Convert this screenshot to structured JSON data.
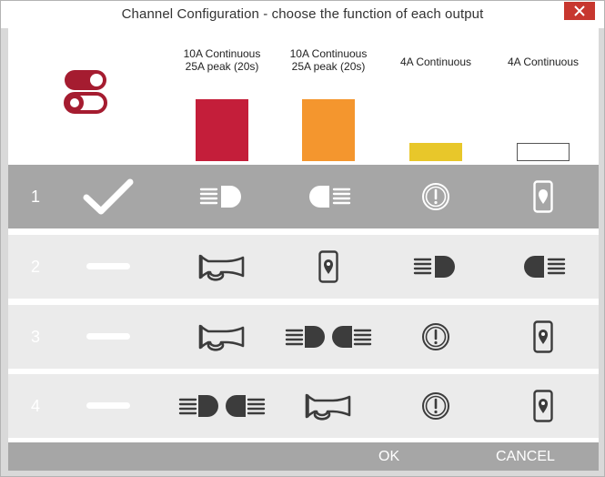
{
  "window": {
    "title": "Channel Configuration - choose the function of each output"
  },
  "columns": [
    {
      "label": "10A Continuous\n25A peak (20s)",
      "color": "#c41e3a",
      "swatch": "tall"
    },
    {
      "label": "10A Continuous\n25A peak (20s)",
      "color": "#f4962e",
      "swatch": "tall"
    },
    {
      "label": "4A Continuous",
      "color": "#e8c72a",
      "swatch": "short"
    },
    {
      "label": "4A Continuous",
      "color": "#ffffff",
      "swatch": "short"
    }
  ],
  "rows": [
    {
      "number": "1",
      "selected": true,
      "cells": [
        "check-icon",
        "headlight-right-icon",
        "headlight-left-icon",
        "warning-icon",
        "phone-location-icon"
      ]
    },
    {
      "number": "2",
      "selected": false,
      "cells": [
        "dash-icon",
        "horn-icon",
        "phone-location-icon",
        "headlight-right-icon",
        "headlight-left-icon"
      ]
    },
    {
      "number": "3",
      "selected": false,
      "cells": [
        "dash-icon",
        "horn-icon",
        "double-headlight-icon",
        "warning-icon",
        "phone-location-icon"
      ]
    },
    {
      "number": "4",
      "selected": false,
      "cells": [
        "dash-icon",
        "double-headlight-icon",
        "horn-icon",
        "warning-icon",
        "phone-location-icon"
      ]
    }
  ],
  "buttons": {
    "ok": "OK",
    "cancel": "CANCEL"
  },
  "colors": {
    "selected_row": "#a6a6a6",
    "row": "#ebebeb",
    "icon_dark": "#3c3c3c",
    "brand_red": "#a51c30"
  }
}
